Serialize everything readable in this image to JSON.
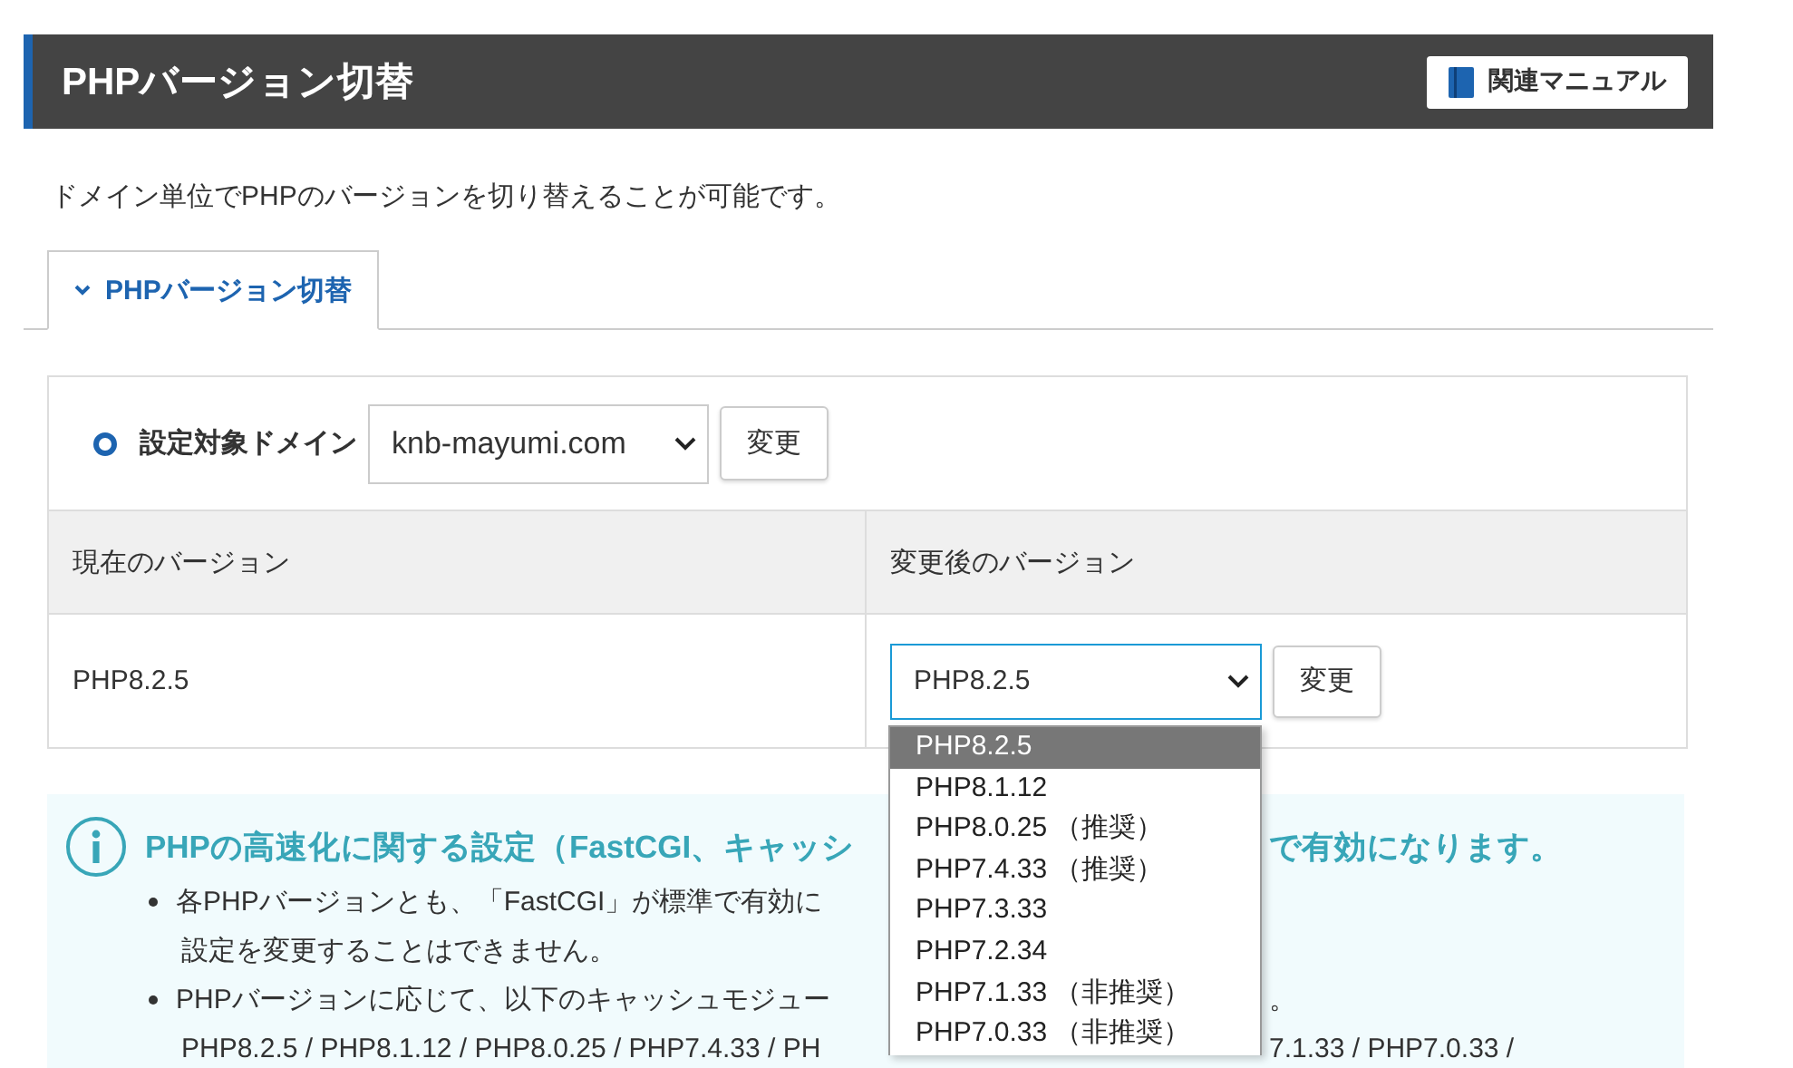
{
  "header": {
    "title": "PHPバージョン切替",
    "manual_button": "関連マニュアル"
  },
  "description": "ドメイン単位でPHPのバージョンを切り替えることが可能です。",
  "tabs": [
    {
      "label": "PHPバージョン切替",
      "selected": true
    }
  ],
  "domain": {
    "label": "設定対象ドメイン",
    "value": "knb-mayumi.com",
    "button": "変更"
  },
  "table": {
    "columns": [
      "現在のバージョン",
      "変更後のバージョン"
    ],
    "rows": [
      {
        "current": "PHP8.2.5",
        "new_value": "PHP8.2.5",
        "button": "変更"
      }
    ]
  },
  "version_dropdown": {
    "expanded": true,
    "options": [
      {
        "label": "PHP8.2.5",
        "selected": true
      },
      {
        "label": "PHP8.1.12",
        "selected": false
      },
      {
        "label": "PHP8.0.25 （推奨）",
        "selected": false
      },
      {
        "label": "PHP7.4.33 （推奨）",
        "selected": false
      },
      {
        "label": "PHP7.3.33",
        "selected": false
      },
      {
        "label": "PHP7.2.34",
        "selected": false
      },
      {
        "label": "PHP7.1.33 （非推奨）",
        "selected": false
      },
      {
        "label": "PHP7.0.33 （非推奨）",
        "selected": false
      }
    ]
  },
  "info": {
    "heading": [
      "PHPの高速化に関する設定（FastCGI、キャッシ",
      "で有効になります。"
    ],
    "lines": [
      {
        "kind": "bullet",
        "parts": [
          "各PHPバージョンとも、「FastCGI」が標準で有効に"
        ]
      },
      {
        "kind": "continued",
        "parts": [
          "設定を変更することはできません。"
        ]
      },
      {
        "kind": "bullet",
        "parts": [
          "PHPバージョンに応じて、以下のキャッシュモジュー",
          "。"
        ]
      },
      {
        "kind": "continued",
        "parts": [
          "PHP8.2.5 / PHP8.1.12 / PHP8.0.25 / PHP7.4.33 / PH",
          "7.1.33 / PHP7.0.33 /"
        ]
      }
    ]
  }
}
